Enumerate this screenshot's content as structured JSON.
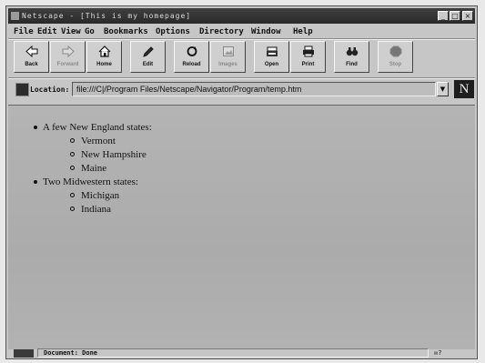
{
  "window": {
    "title": "Netscape - [This is my homepage]",
    "controls": [
      "_",
      "□",
      "×"
    ]
  },
  "menu": {
    "items": [
      "File",
      "Edit",
      "View",
      "Go",
      "Bookmarks",
      "Options",
      "Directory",
      "Window",
      "Help"
    ]
  },
  "toolbar": {
    "buttons": [
      {
        "label": "Back",
        "icon": "back-arrow-icon",
        "enabled": true
      },
      {
        "label": "Forward",
        "icon": "forward-arrow-icon",
        "enabled": false
      },
      {
        "label": "Home",
        "icon": "home-icon",
        "enabled": true
      },
      {
        "label": "Edit",
        "icon": "pencil-icon",
        "enabled": true
      },
      {
        "label": "Reload",
        "icon": "reload-icon",
        "enabled": true
      },
      {
        "label": "Images",
        "icon": "images-icon",
        "enabled": false
      },
      {
        "label": "Open",
        "icon": "open-icon",
        "enabled": true
      },
      {
        "label": "Print",
        "icon": "printer-icon",
        "enabled": true
      },
      {
        "label": "Find",
        "icon": "binoculars-icon",
        "enabled": true
      },
      {
        "label": "Stop",
        "icon": "stop-icon",
        "enabled": false
      }
    ]
  },
  "location": {
    "label": "Location:",
    "url": "file:///C|/Program Files/Netscape/Navigator/Program/temp.htm",
    "logo": "N"
  },
  "content": {
    "lists": [
      {
        "heading": "A few New England states:",
        "items": [
          "Vermont",
          "New Hampshire",
          "Maine"
        ]
      },
      {
        "heading": "Two Midwestern states:",
        "items": [
          "Michigan",
          "Indiana"
        ]
      }
    ]
  },
  "status": {
    "text": "Document: Done",
    "right": "✉?"
  }
}
